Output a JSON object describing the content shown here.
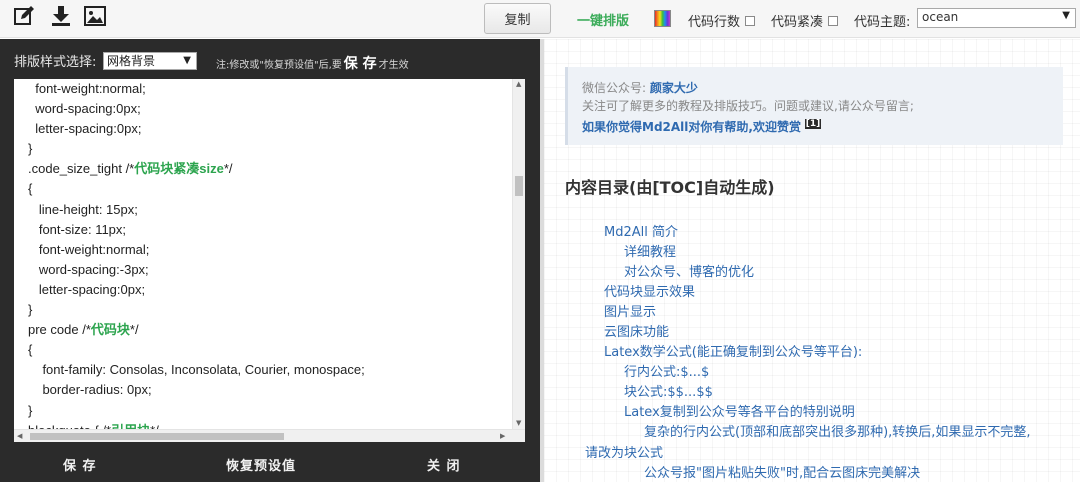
{
  "toolbar": {
    "copy_label": "复制",
    "onekey_label": "一键排版",
    "line_numbers_label": "代码行数",
    "code_compact_label": "代码紧凑",
    "code_theme_label": "代码主题:",
    "code_theme_value": "ocean"
  },
  "editor": {
    "style_label": "排版样式选择:",
    "style_value": "网格背景",
    "note_prefix": "注:修改或\"恢复预设值\"后,要",
    "note_save": "保 存",
    "note_suffix": "才生效",
    "save_button": "保 存",
    "reset_button": "恢复预设值",
    "close_button": "关 闭",
    "code_lines": [
      {
        "indent": "  ",
        "text": "font-weight:normal;",
        "comment": ""
      },
      {
        "indent": "  ",
        "text": "word-spacing:0px;",
        "comment": ""
      },
      {
        "indent": "  ",
        "text": "letter-spacing:0px;",
        "comment": ""
      },
      {
        "indent": "",
        "text": "}",
        "comment": ""
      },
      {
        "indent": "",
        "text": ".code_size_tight /*",
        "comment": "代码块紧凑size",
        "tail": "*/"
      },
      {
        "indent": "",
        "text": "{",
        "comment": ""
      },
      {
        "indent": "   ",
        "text": "line-height: 15px;",
        "comment": ""
      },
      {
        "indent": "   ",
        "text": "font-size: 11px;",
        "comment": ""
      },
      {
        "indent": "   ",
        "text": "font-weight:normal;",
        "comment": ""
      },
      {
        "indent": "   ",
        "text": "word-spacing:-3px;",
        "comment": ""
      },
      {
        "indent": "   ",
        "text": "letter-spacing:0px;",
        "comment": ""
      },
      {
        "indent": "",
        "text": "}",
        "comment": ""
      },
      {
        "indent": "",
        "text": "pre code /*",
        "comment": "代码块",
        "tail": "*/"
      },
      {
        "indent": "",
        "text": "{",
        "comment": ""
      },
      {
        "indent": "    ",
        "text": "font-family: Consolas, Inconsolata, Courier, monospace;",
        "comment": ""
      },
      {
        "indent": "    ",
        "text": "border-radius: 0px;",
        "comment": ""
      },
      {
        "indent": "",
        "text": "}",
        "comment": ""
      },
      {
        "indent": "",
        "text": "blockquote { /*",
        "comment": "引用块",
        "tail": "*/"
      }
    ]
  },
  "preview": {
    "wechat_label": "微信公众号:",
    "wechat_name": "颜家大少",
    "follow_text": "关注可了解更多的教程及排版技巧。问题或建议,请公众号留言;",
    "support_text": "如果你觉得Md2All对你有帮助,欢迎赞赏",
    "support_ref": "[1]",
    "toc_title": "内容目录(由[TOC]自动生成)",
    "toc_items": [
      "Md2All 简介",
      "详细教程",
      "对公众号、博客的优化",
      "代码块显示效果",
      "图片显示",
      "云图床功能",
      "Latex数学公式(能正确复制到公众号等平台):",
      "行内公式:$...$",
      "块公式:$$...$$",
      "Latex复制到公众号等各平台的特别说明",
      "复杂的行内公式(顶部和底部突出很多那种),转换后,如果显示不完整,",
      "请改为块公式",
      "公众号报\"图片粘贴失败\"时,配合云图床完美解决"
    ]
  }
}
